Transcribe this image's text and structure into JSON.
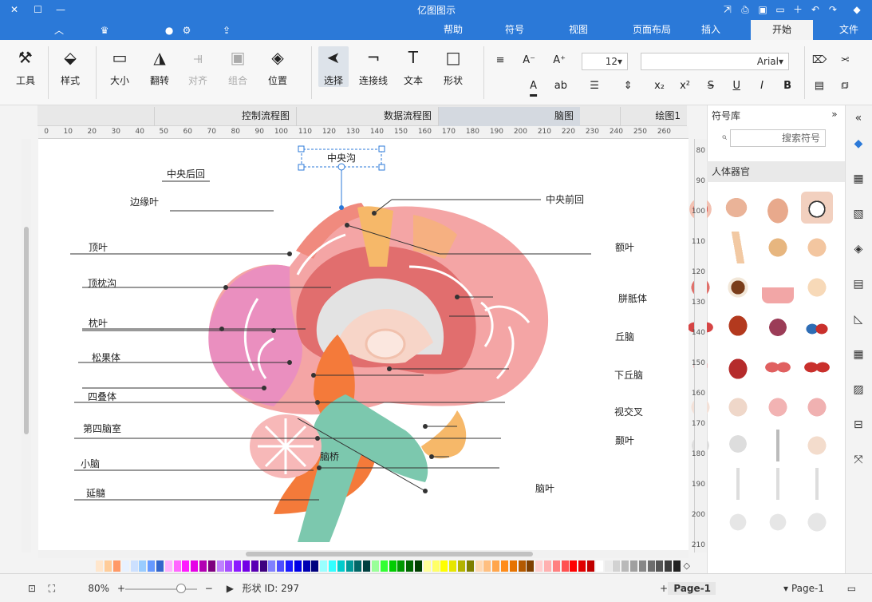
{
  "window": {
    "title": "亿图图示",
    "close_label": "✕",
    "max_label": "☐",
    "min_label": "—"
  },
  "menubar": {
    "tabs": [
      "文件",
      "开始",
      "插入",
      "页面布局",
      "视图",
      "符号",
      "帮助"
    ],
    "active": "开始"
  },
  "ribbon": {
    "tools": {
      "select": "选择",
      "shape": "形状",
      "text": "文本",
      "connector": "连接线",
      "position": "位置",
      "group": "组合",
      "align": "对齐",
      "flip": "翻转",
      "size": "大小",
      "style": "样式",
      "tool": "工具"
    },
    "font_name": "Arial",
    "font_size": "12"
  },
  "library": {
    "header": "符号库",
    "search_placeholder": "搜索符号",
    "category": "人体器官"
  },
  "doc_tabs": [
    {
      "label": "绘图1",
      "active": false
    },
    {
      "label": "脑图",
      "active": true
    },
    {
      "label": "数据流程图",
      "active": false
    },
    {
      "label": "控制流程图",
      "active": false
    }
  ],
  "ruler_h": [
    "0",
    "10",
    "20",
    "30",
    "40",
    "50",
    "60",
    "70",
    "80",
    "90",
    "100",
    "110",
    "120",
    "130",
    "140",
    "150",
    "160",
    "170",
    "180",
    "190",
    "200",
    "210",
    "220",
    "230",
    "240",
    "250",
    "260"
  ],
  "ruler_v": [
    "80",
    "90",
    "100",
    "110",
    "120",
    "130",
    "140",
    "150",
    "160",
    "170",
    "180",
    "190",
    "200",
    "210"
  ],
  "diagram": {
    "labels_left": [
      "中央后回",
      "边缘叶",
      "顶叶",
      "顶枕沟",
      "枕叶",
      "松果体",
      "四叠体",
      "第四脑室",
      "小脑",
      "延髓"
    ],
    "labels_right": [
      "中央前回",
      "额叶",
      "胼胝体",
      "丘脑",
      "下丘脑",
      "视交叉",
      "颞叶",
      "脑叶"
    ],
    "top_label": "中央沟",
    "brainstem_label": "脑桥"
  },
  "statusbar": {
    "page_selector": "Page-1",
    "page_tab": "Page-1",
    "add": "+",
    "shape_id": "形状 ID: 297",
    "zoom": "80%"
  },
  "palette_colors": [
    "#222222",
    "#3c3c3c",
    "#555555",
    "#6e6e6e",
    "#878787",
    "#a0a0a0",
    "#b9b9b9",
    "#d2d2d2",
    "#ebebeb",
    "#ffffff",
    "#c00000",
    "#e00000",
    "#ff0000",
    "#ff5050",
    "#ff8080",
    "#ffb0b0",
    "#ffd0d0",
    "#7f3f00",
    "#b35900",
    "#e67300",
    "#ff8c1a",
    "#ffa64d",
    "#ffbf80",
    "#ffd9b3",
    "#7f7f00",
    "#b3b300",
    "#e6e600",
    "#ffff00",
    "#ffff66",
    "#ffff99",
    "#003f00",
    "#006600",
    "#009900",
    "#00cc00",
    "#33ff33",
    "#99ff99",
    "#004040",
    "#006666",
    "#009999",
    "#00cccc",
    "#33ffff",
    "#99ffff",
    "#00007f",
    "#0000b3",
    "#0000e6",
    "#1a1aff",
    "#4d4dff",
    "#8080ff",
    "#3f007f",
    "#5900b3",
    "#7300e6",
    "#8c1aff",
    "#a64dff",
    "#bf80ff",
    "#7f007f",
    "#b300b3",
    "#e600e6",
    "#ff1aff",
    "#ff66ff",
    "#ffb3ff",
    "#3366cc",
    "#6699ff",
    "#99ccff",
    "#cce0ff",
    "#e8f1ff",
    "#ff9966",
    "#ffcc99",
    "#ffe6cc"
  ]
}
